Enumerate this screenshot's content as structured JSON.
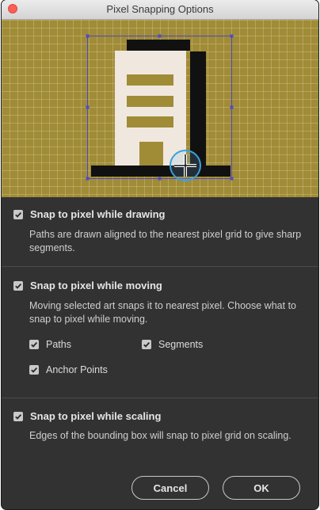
{
  "window": {
    "title": "Pixel Snapping Options"
  },
  "colors": {
    "accent_bg": "#a08b37",
    "grid_line": "#c9b97a",
    "building_fill": "#f0e8de",
    "selection": "#4c4cc8",
    "cursor_ring": "#3aa0e0",
    "panel_bg": "#323232"
  },
  "icons": [
    "close-dot",
    "check-icon",
    "snap-cursor-icon"
  ],
  "sections": {
    "drawing": {
      "label": "Snap to pixel while drawing",
      "checked": true,
      "description": "Paths are drawn aligned to the nearest pixel grid to give sharp segments."
    },
    "moving": {
      "label": "Snap to pixel while moving",
      "checked": true,
      "description": "Moving selected art snaps it to nearest pixel. Choose what to snap to pixel while moving.",
      "options": {
        "paths": {
          "label": "Paths",
          "checked": true
        },
        "segments": {
          "label": "Segments",
          "checked": true
        },
        "anchor_points": {
          "label": "Anchor Points",
          "checked": true
        }
      }
    },
    "scaling": {
      "label": "Snap to pixel while scaling",
      "checked": true,
      "description": "Edges of the bounding box will snap to pixel grid on scaling."
    }
  },
  "buttons": {
    "cancel": "Cancel",
    "ok": "OK"
  }
}
